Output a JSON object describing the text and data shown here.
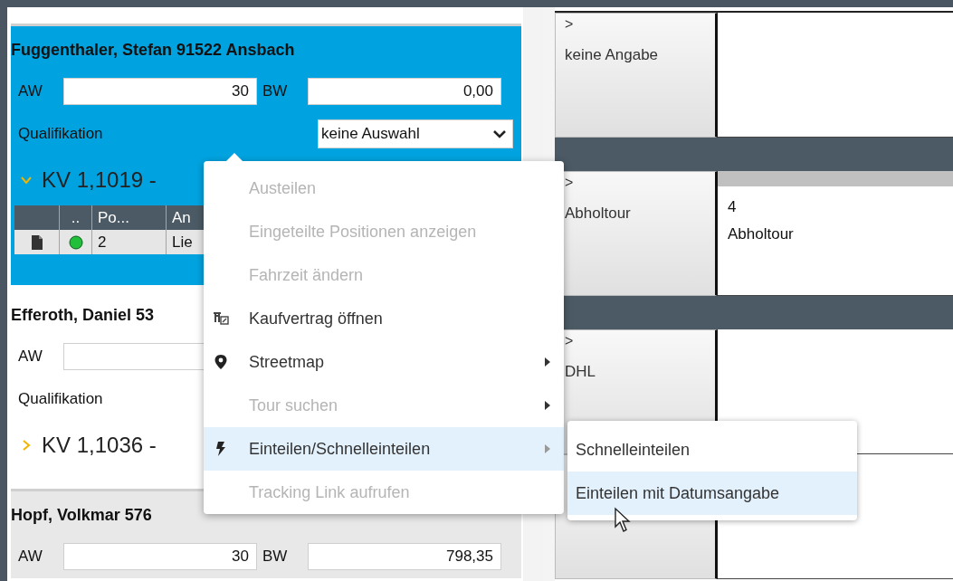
{
  "customers": [
    {
      "name": "Fuggenthaler, Stefan 91522 Ansbach",
      "selected": true,
      "fields": [
        {
          "label": "AW",
          "value": "30"
        },
        {
          "label": "BW",
          "value": "0,00"
        }
      ],
      "qualification": {
        "label": "Qualifikation",
        "value": "keine Auswahl"
      },
      "contract": {
        "label": "KV 1,1019 -",
        "expanded": true,
        "columns": [
          "",
          "..",
          "Po...",
          "An"
        ],
        "rows": [
          {
            "cells": [
              "",
              "",
              "2",
              "Lie"
            ]
          }
        ]
      }
    },
    {
      "name": "Efferoth, Daniel 53",
      "selected": false,
      "fields": [
        {
          "label": "AW"
        }
      ],
      "qualification": {
        "label": "Qualifikation"
      },
      "contract": {
        "label": "KV 1,1036 -",
        "expanded": false
      }
    },
    {
      "name": "Hopf, Volkmar 576",
      "selected": false,
      "fields": [
        {
          "label": "AW",
          "value": "30"
        },
        {
          "label": "BW",
          "value": "798,35"
        }
      ]
    }
  ],
  "context_menu": {
    "items": [
      {
        "label": "Austeilen",
        "disabled": true,
        "highlighted": false,
        "submenu": false
      },
      {
        "label": "Eingeteilte Positionen anzeigen",
        "disabled": true,
        "highlighted": false,
        "submenu": false
      },
      {
        "label": "Fahrzeit ändern",
        "disabled": true,
        "highlighted": false,
        "submenu": false
      },
      {
        "label": "Kaufvertrag öffnen",
        "disabled": false,
        "highlighted": false,
        "submenu": false
      },
      {
        "label": "Streetmap",
        "disabled": false,
        "highlighted": false,
        "submenu": true
      },
      {
        "label": "Tour suchen",
        "disabled": true,
        "highlighted": false,
        "submenu": true
      },
      {
        "label": "Einteilen/Schnelleinteilen",
        "disabled": false,
        "highlighted": true,
        "submenu": true
      },
      {
        "label": "Tracking Link aufrufen",
        "disabled": true,
        "highlighted": false,
        "submenu": false
      }
    ],
    "submenu": [
      {
        "label": "Schnelleinteilen",
        "highlighted": false
      },
      {
        "label": "Einteilen mit Datumsangabe",
        "highlighted": true
      }
    ]
  },
  "tour_groups": [
    {
      "lanes": [
        {
          "glyph": ">",
          "label": "keine Angabe"
        }
      ]
    },
    {
      "lanes": [
        {
          "glyph": ">",
          "label": "Abholtour",
          "lines": [
            "4",
            "Abholtour"
          ]
        }
      ]
    },
    {
      "lanes": [
        {
          "glyph": ">",
          "label": "DHL"
        }
      ]
    }
  ]
}
